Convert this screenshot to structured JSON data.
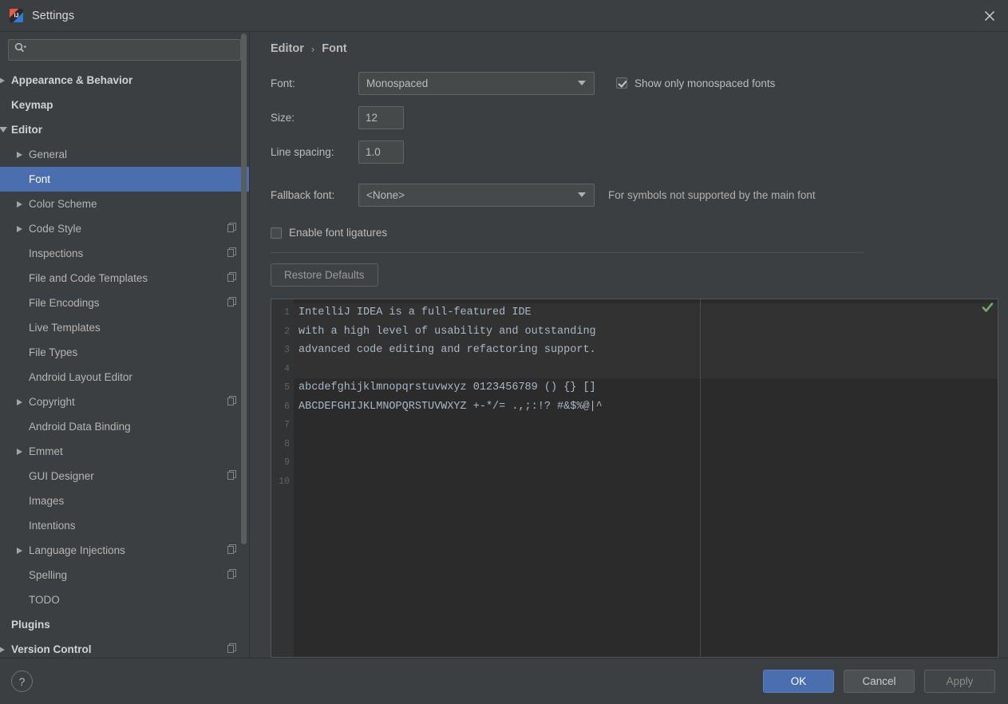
{
  "window": {
    "title": "Settings",
    "app_icon": "intellij-idea-icon",
    "close_icon": "close-icon"
  },
  "search": {
    "value": "",
    "placeholder": "",
    "icon": "search-icon"
  },
  "sidebar": {
    "scrollbar": "vertical-scrollbar",
    "items": [
      {
        "label": "Appearance & Behavior",
        "depth": 0,
        "arrow": "collapsed",
        "style": "bold",
        "selected": false,
        "copy_icon": false
      },
      {
        "label": "Keymap",
        "depth": 0,
        "arrow": "none",
        "style": "bold",
        "selected": false,
        "copy_icon": false
      },
      {
        "label": "Editor",
        "depth": 0,
        "arrow": "expanded",
        "style": "bold",
        "selected": false,
        "copy_icon": false
      },
      {
        "label": "General",
        "depth": 1,
        "arrow": "collapsed",
        "style": "plain",
        "selected": false,
        "copy_icon": false
      },
      {
        "label": "Font",
        "depth": 1,
        "arrow": "none",
        "style": "plain",
        "selected": true,
        "copy_icon": false
      },
      {
        "label": "Color Scheme",
        "depth": 1,
        "arrow": "collapsed",
        "style": "plain",
        "selected": false,
        "copy_icon": false
      },
      {
        "label": "Code Style",
        "depth": 1,
        "arrow": "collapsed",
        "style": "plain",
        "selected": false,
        "copy_icon": true
      },
      {
        "label": "Inspections",
        "depth": 1,
        "arrow": "none",
        "style": "plain",
        "selected": false,
        "copy_icon": true
      },
      {
        "label": "File and Code Templates",
        "depth": 1,
        "arrow": "none",
        "style": "plain",
        "selected": false,
        "copy_icon": true
      },
      {
        "label": "File Encodings",
        "depth": 1,
        "arrow": "none",
        "style": "plain",
        "selected": false,
        "copy_icon": true
      },
      {
        "label": "Live Templates",
        "depth": 1,
        "arrow": "none",
        "style": "plain",
        "selected": false,
        "copy_icon": false
      },
      {
        "label": "File Types",
        "depth": 1,
        "arrow": "none",
        "style": "plain",
        "selected": false,
        "copy_icon": false
      },
      {
        "label": "Android Layout Editor",
        "depth": 1,
        "arrow": "none",
        "style": "plain",
        "selected": false,
        "copy_icon": false
      },
      {
        "label": "Copyright",
        "depth": 1,
        "arrow": "collapsed",
        "style": "plain",
        "selected": false,
        "copy_icon": true
      },
      {
        "label": "Android Data Binding",
        "depth": 1,
        "arrow": "none",
        "style": "plain",
        "selected": false,
        "copy_icon": false
      },
      {
        "label": "Emmet",
        "depth": 1,
        "arrow": "collapsed",
        "style": "plain",
        "selected": false,
        "copy_icon": false
      },
      {
        "label": "GUI Designer",
        "depth": 1,
        "arrow": "none",
        "style": "plain",
        "selected": false,
        "copy_icon": true
      },
      {
        "label": "Images",
        "depth": 1,
        "arrow": "none",
        "style": "plain",
        "selected": false,
        "copy_icon": false
      },
      {
        "label": "Intentions",
        "depth": 1,
        "arrow": "none",
        "style": "plain",
        "selected": false,
        "copy_icon": false
      },
      {
        "label": "Language Injections",
        "depth": 1,
        "arrow": "collapsed",
        "style": "plain",
        "selected": false,
        "copy_icon": true
      },
      {
        "label": "Spelling",
        "depth": 1,
        "arrow": "none",
        "style": "plain",
        "selected": false,
        "copy_icon": true
      },
      {
        "label": "TODO",
        "depth": 1,
        "arrow": "none",
        "style": "plain",
        "selected": false,
        "copy_icon": false
      },
      {
        "label": "Plugins",
        "depth": 0,
        "arrow": "none",
        "style": "bold",
        "selected": false,
        "copy_icon": false
      },
      {
        "label": "Version Control",
        "depth": 0,
        "arrow": "collapsed",
        "style": "bold",
        "selected": false,
        "copy_icon": true
      }
    ]
  },
  "main": {
    "breadcrumb": {
      "parent": "Editor",
      "separator": "›",
      "current": "Font"
    },
    "font_row": {
      "label": "Font:",
      "value": "Monospaced"
    },
    "size_row": {
      "label": "Size:",
      "value": "12"
    },
    "line_spacing_row": {
      "label": "Line spacing:",
      "value": "1.0"
    },
    "fallback_row": {
      "label": "Fallback font:",
      "value": "<None>",
      "hint": "For symbols not supported by the main font"
    },
    "show_monospaced": {
      "label": "Show only monospaced fonts",
      "checked": true
    },
    "ligatures": {
      "label": "Enable font ligatures",
      "checked": false
    },
    "restore_defaults": {
      "label": "Restore Defaults",
      "enabled": false
    }
  },
  "preview": {
    "inspection_icon": "green-checkmark-icon",
    "line_numbers": [
      "1",
      "2",
      "3",
      "4",
      "5",
      "6",
      "7",
      "8",
      "9",
      "10"
    ],
    "lines": [
      "IntelliJ IDEA is a full-featured IDE",
      "with a high level of usability and outstanding",
      "advanced code editing and refactoring support.",
      "",
      "abcdefghijklmnopqrstuvwxyz 0123456789 () {} []",
      "ABCDEFGHIJKLMNOPQRSTUVWXYZ +-*/= .,;:!? #&$%@|^",
      "",
      "",
      "",
      ""
    ]
  },
  "footer": {
    "help_label": "?",
    "ok_label": "OK",
    "cancel_label": "Cancel",
    "apply_label": "Apply",
    "apply_enabled": false
  },
  "colors": {
    "window_bg": "#3c3f41",
    "selection_blue": "#4b6eaf",
    "field_bg": "#45494a",
    "editor_bg": "#2b2b2b",
    "gutter_bg": "#313335",
    "text": "#bbbbbb",
    "code_text": "#a9b7c6",
    "inspection_green": "#69a668"
  }
}
